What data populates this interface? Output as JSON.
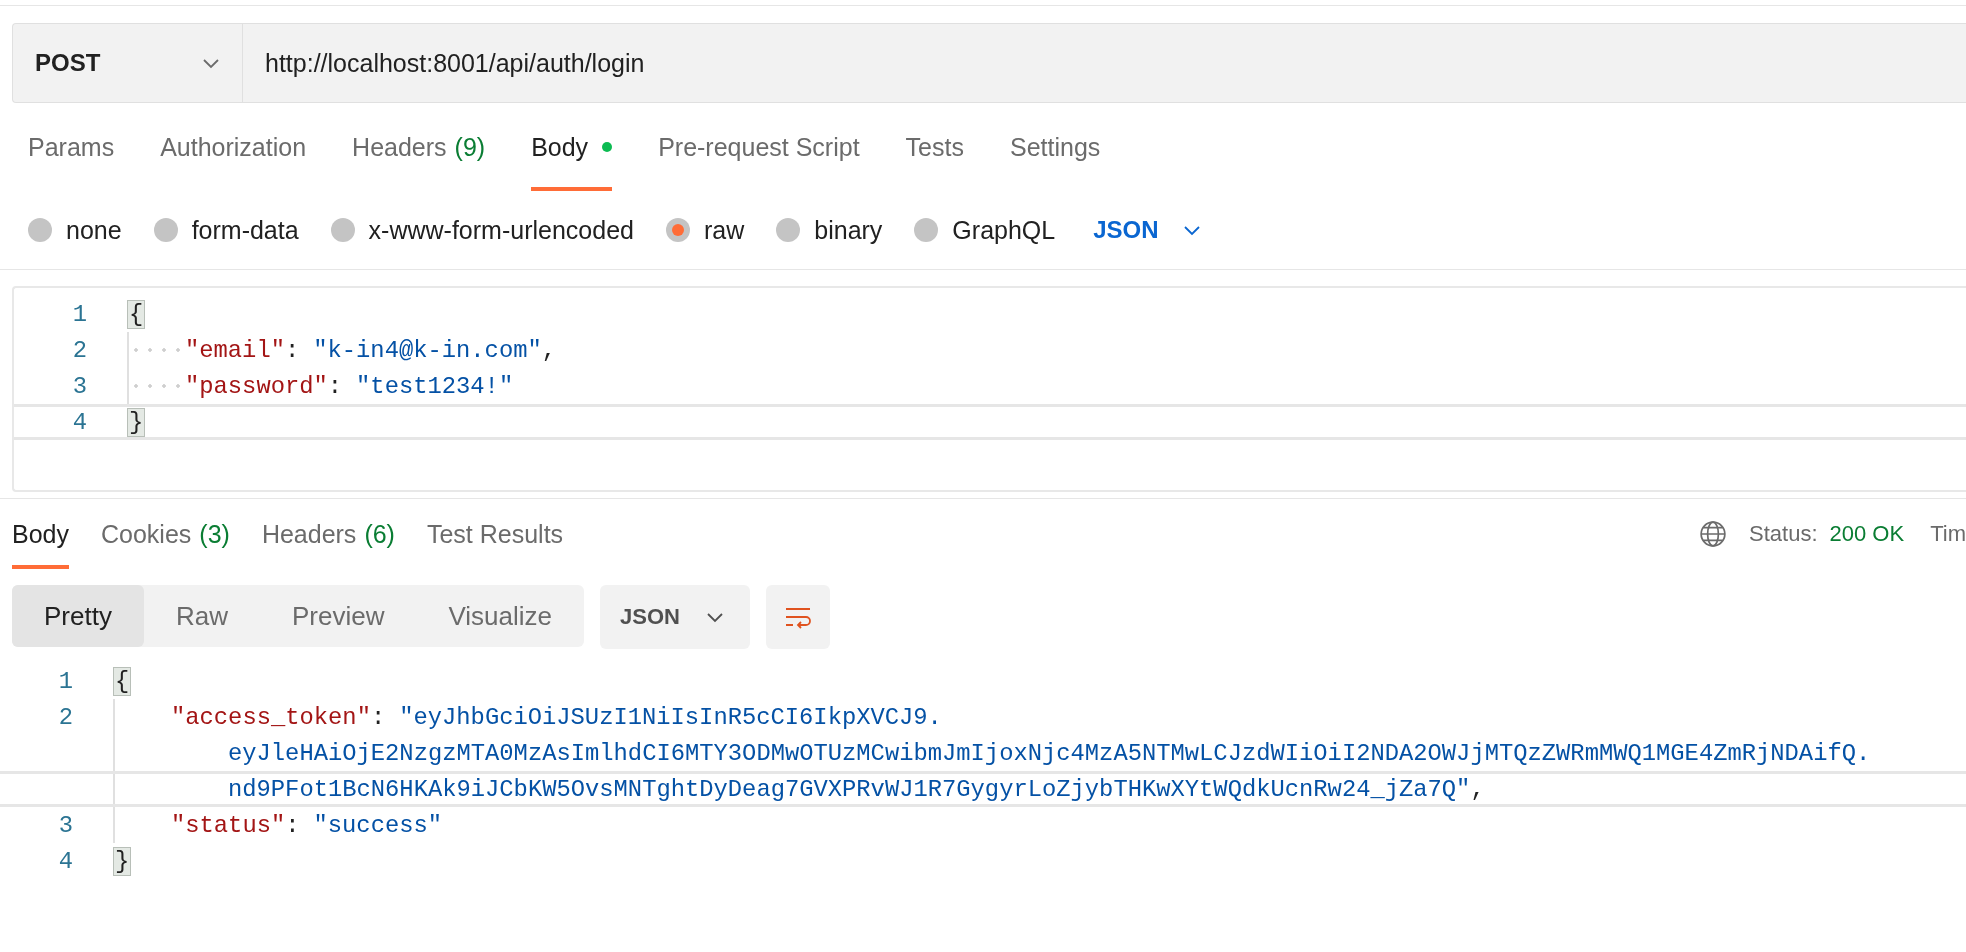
{
  "request": {
    "method": "POST",
    "url": "http://localhost:8001/api/auth/login"
  },
  "request_tabs": [
    {
      "label": "Params",
      "selected": false
    },
    {
      "label": "Authorization",
      "selected": false
    },
    {
      "label": "Headers",
      "count": "(9)",
      "selected": false
    },
    {
      "label": "Body",
      "dot": true,
      "selected": true
    },
    {
      "label": "Pre-request Script",
      "selected": false
    },
    {
      "label": "Tests",
      "selected": false
    },
    {
      "label": "Settings",
      "selected": false
    }
  ],
  "body_types": [
    {
      "label": "none",
      "selected": false
    },
    {
      "label": "form-data",
      "selected": false
    },
    {
      "label": "x-www-form-urlencoded",
      "selected": false
    },
    {
      "label": "raw",
      "selected": true
    },
    {
      "label": "binary",
      "selected": false
    },
    {
      "label": "GraphQL",
      "selected": false
    }
  ],
  "raw_format": "JSON",
  "request_body": [
    {
      "number": "1",
      "kind": "brace",
      "text": "{",
      "active": false
    },
    {
      "number": "2",
      "kind": "pair",
      "key": "\"email\"",
      "colon": ":",
      "value": [
        "\"k-in4@k-in.com\""
      ],
      "trailing": ",",
      "active": false
    },
    {
      "number": "3",
      "kind": "pair",
      "key": "\"password\"",
      "colon": ":",
      "value": [
        "\"test1234!\""
      ],
      "active": false
    },
    {
      "number": "4",
      "kind": "brace",
      "text": "}",
      "active": true
    }
  ],
  "response_tabs": [
    {
      "label": "Body",
      "selected": true
    },
    {
      "label": "Cookies",
      "count": "(3)",
      "selected": false
    },
    {
      "label": "Headers",
      "count": "(6)",
      "selected": false
    },
    {
      "label": "Test Results",
      "selected": false
    }
  ],
  "status": {
    "label": "Status:",
    "value": "200 OK",
    "cut_label": "Tim"
  },
  "view_modes": [
    {
      "label": "Pretty",
      "selected": true
    },
    {
      "label": "Raw",
      "selected": false
    },
    {
      "label": "Preview",
      "selected": false
    },
    {
      "label": "Visualize",
      "selected": false
    }
  ],
  "response_format": "JSON",
  "response_body": [
    {
      "number": "1",
      "kind": "brace",
      "text": "{",
      "active": false
    },
    {
      "number": "2",
      "kind": "pair",
      "key": "\"access_token\"",
      "colon": ":",
      "value": [
        "\"eyJhbGciOiJSUzI1NiIsInR5cCI6IkpXVCJ9.",
        "eyJleHAiOjE2NzgzMTA0MzAsImlhdCI6MTY3ODMwOTUzMCwibmJmIjoxNjc4MzA5NTMwLCJzdWIiOiI2NDA2OWJjMTQzZWRmMWQ1MGE4ZmRjNDAifQ.",
        "nd9PFot1BcN6HKAk9iJCbKW5OvsMNTghtDyDeag7GVXPRvWJ1R7GygyrLoZjybTHKwXYtWQdkUcnRw24_jZa7Q\""
      ],
      "trailing": ",",
      "active": true
    },
    {
      "number": "3",
      "kind": "pair",
      "key": "\"status\"",
      "colon": ":",
      "value": [
        "\"success\""
      ],
      "active": false
    },
    {
      "number": "4",
      "kind": "brace",
      "text": "}",
      "active": false
    }
  ]
}
